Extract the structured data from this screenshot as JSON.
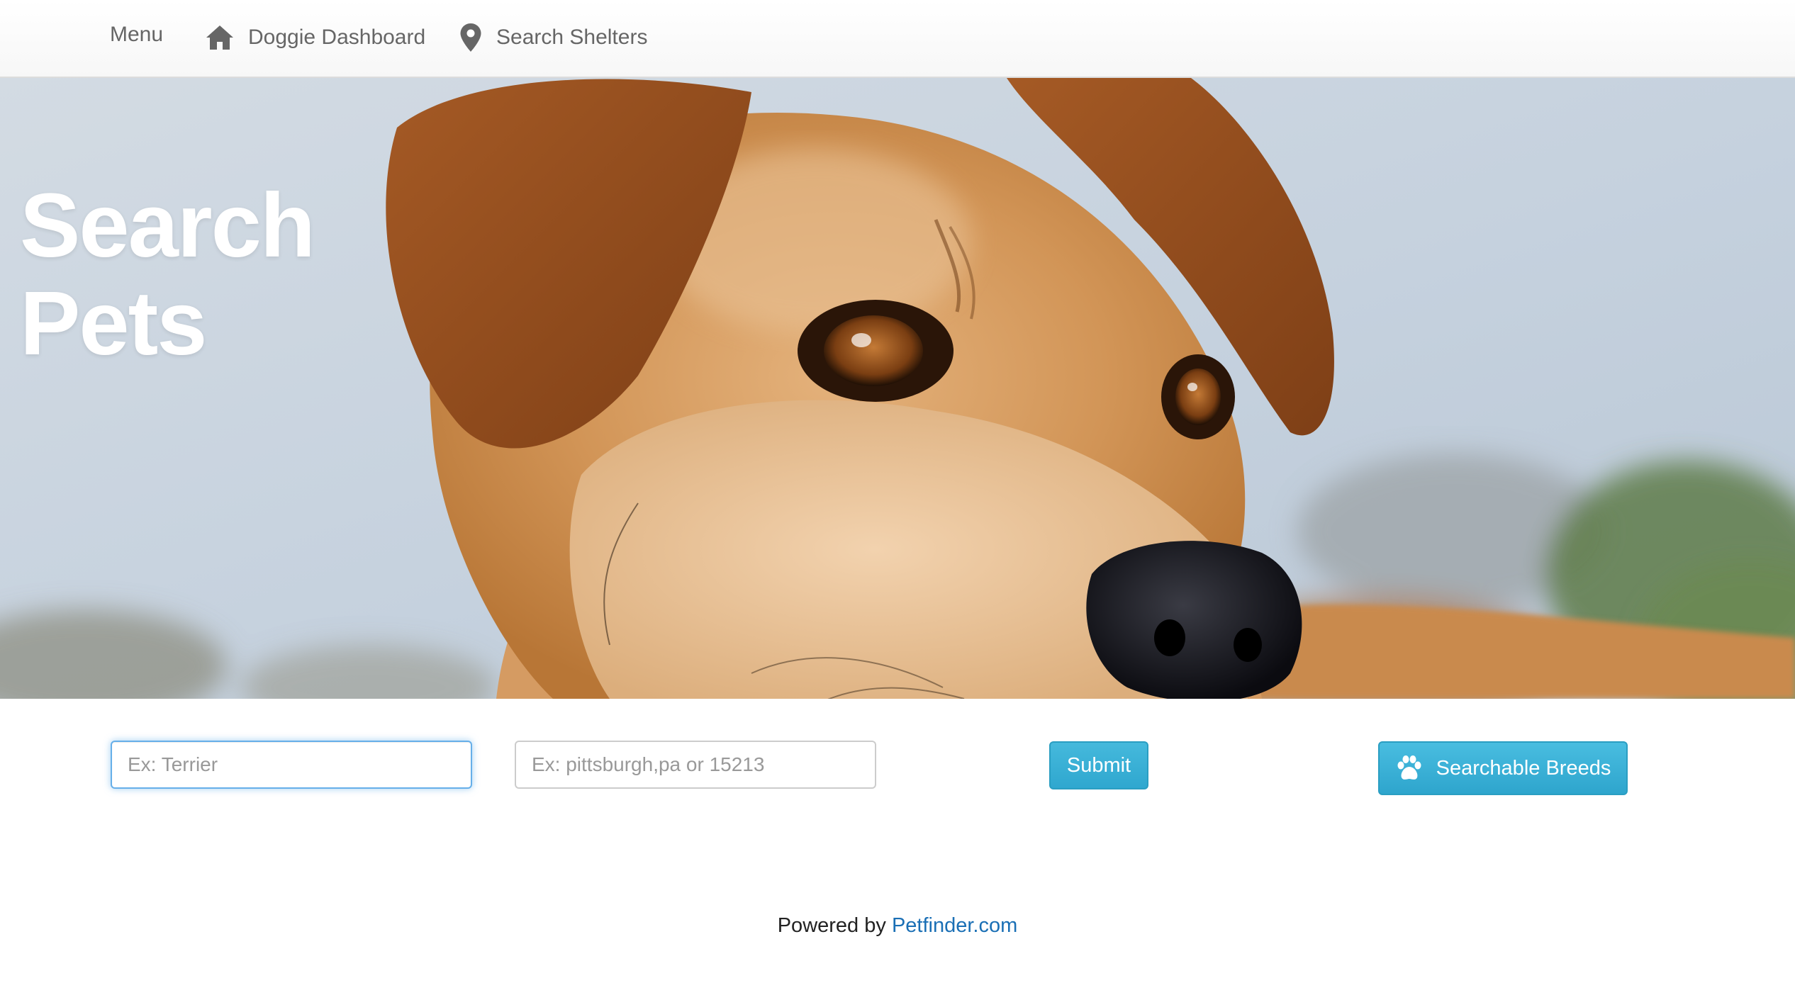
{
  "nav": {
    "menu_label": "Menu",
    "items": [
      {
        "label": "Doggie Dashboard",
        "icon": "home-icon"
      },
      {
        "label": "Search Shelters",
        "icon": "map-pin-icon"
      }
    ]
  },
  "hero": {
    "title": "Search\nPets",
    "image": "dog-photo"
  },
  "search": {
    "breed_placeholder": "Ex: Terrier",
    "breed_value": "",
    "location_placeholder": "Ex: pittsburgh,pa or 15213",
    "location_value": "",
    "submit_label": "Submit",
    "breeds_button_label": "Searchable Breeds",
    "breeds_button_icon": "paw-icon"
  },
  "footer": {
    "prefix": "Powered by",
    "link_text": "Petfinder.com"
  },
  "colors": {
    "accent": "#31b0d5",
    "link": "#1a6fb5",
    "nav_text": "#666666"
  }
}
